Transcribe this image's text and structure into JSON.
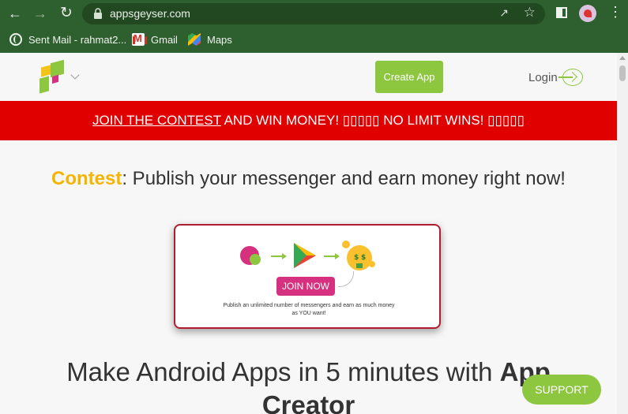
{
  "browser": {
    "url": "appsgeyser.com",
    "bookmarks": [
      {
        "label": "Sent Mail - rahmat2...",
        "icon": "globe-icon"
      },
      {
        "label": "Gmail",
        "icon": "gmail-icon"
      },
      {
        "label": "Maps",
        "icon": "maps-icon"
      }
    ]
  },
  "header": {
    "create_app_label": "Create App",
    "login_label": "Login"
  },
  "banner": {
    "link_text": "JOIN THE CONTEST",
    "text_part1": " AND WIN MONEY! ▯▯▯▯▯ NO LIMIT WINS! ▯▯▯▯▯"
  },
  "contest": {
    "highlight": "Contest",
    "text": ": Publish your messenger and earn money right now!",
    "join_label": "JOIN NOW",
    "card_text": "Publish an unlimited number of messengers and earn as much money as YOU want!"
  },
  "main": {
    "title_part1": "Make Android Apps in 5 minutes with ",
    "title_bold": "App Creator"
  },
  "support_label": "SUPPORT",
  "colors": {
    "chrome": "#2e5f2e",
    "accent_green": "#8dc63f",
    "banner_red": "#e00000",
    "contest_yellow": "#f4b400",
    "join_pink": "#d6317f"
  }
}
